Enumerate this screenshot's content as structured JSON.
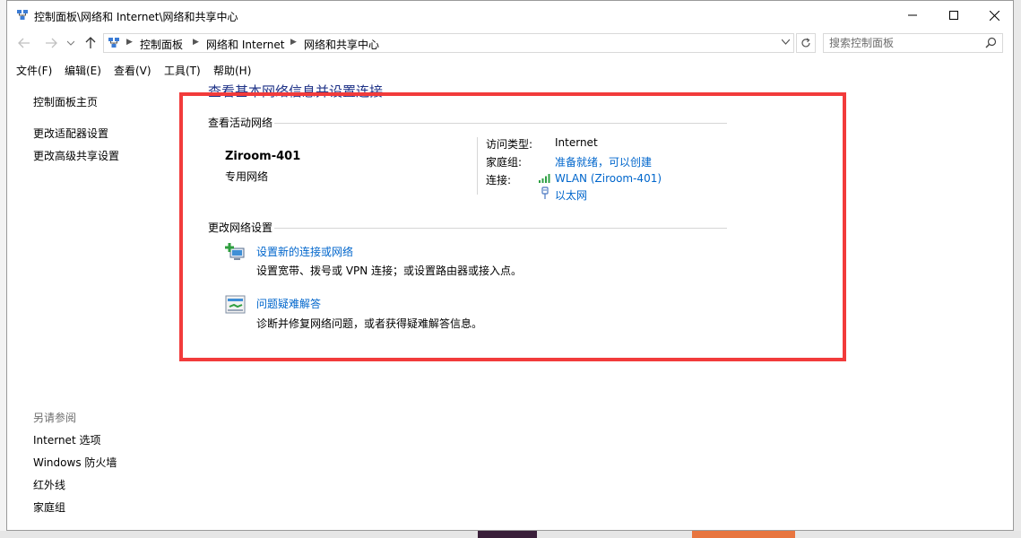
{
  "window": {
    "title": "控制面板\\网络和 Internet\\网络和共享中心"
  },
  "address": {
    "crumbs": [
      "控制面板",
      "网络和 Internet",
      "网络和共享中心"
    ],
    "search_placeholder": "搜索控制面板"
  },
  "menu": [
    "文件(F)",
    "编辑(E)",
    "查看(V)",
    "工具(T)",
    "帮助(H)"
  ],
  "leftnav": {
    "home": "控制面板主页",
    "adapter": "更改适配器设置",
    "sharing": "更改高级共享设置",
    "see_also_title": "另请参阅",
    "see_also": [
      "Internet 选项",
      "Windows 防火墙",
      "红外线",
      "家庭组"
    ]
  },
  "main": {
    "page_title": "查看基本网络信息并设置连接",
    "active_networks_title": "查看活动网络",
    "network": {
      "name": "Ziroom-401",
      "category": "专用网络",
      "access_type_label": "访问类型:",
      "access_type_value": "Internet",
      "homegroup_label": "家庭组:",
      "homegroup_value": "准备就绪，可以创建",
      "connections_label": "连接:",
      "connections": [
        "WLAN (Ziroom-401)",
        "以太网"
      ]
    },
    "change_settings_title": "更改网络设置",
    "tasks": [
      {
        "link": "设置新的连接或网络",
        "desc": "设置宽带、拨号或 VPN 连接；或设置路由器或接入点。",
        "icon": "new-connection-icon"
      },
      {
        "link": "问题疑难解答",
        "desc": "诊断并修复网络问题，或者获得疑难解答信息。",
        "icon": "troubleshoot-icon"
      }
    ]
  },
  "colors": {
    "link": "#0066cc",
    "title_blue": "#1e3287",
    "highlight": "#f23b3b"
  }
}
